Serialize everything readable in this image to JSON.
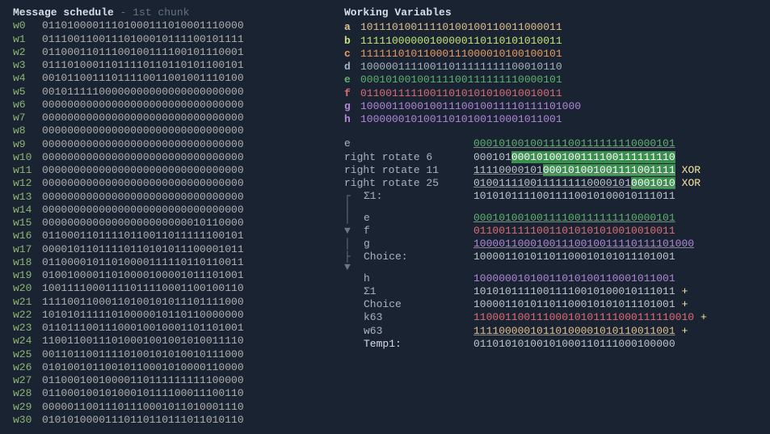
{
  "msgSchedule": {
    "title": "Message schedule",
    "subtitle": " - 1st chunk",
    "words": [
      {
        "label": "w0",
        "val": "01101000011101000111010001110000"
      },
      {
        "label": "w1",
        "val": "01110011001110100010111100101111"
      },
      {
        "label": "w2",
        "val": "01100011011100100111100101110001"
      },
      {
        "label": "w3",
        "val": "01110100011011110110110101100101"
      },
      {
        "label": "w4",
        "val": "00101100111011110011001001110100"
      },
      {
        "label": "w5",
        "val": "00101111100000000000000000000000"
      },
      {
        "label": "w6",
        "val": "00000000000000000000000000000000"
      },
      {
        "label": "w7",
        "val": "00000000000000000000000000000000"
      },
      {
        "label": "w8",
        "val": "00000000000000000000000000000000"
      },
      {
        "label": "w9",
        "val": "00000000000000000000000000000000"
      },
      {
        "label": "w10",
        "val": "00000000000000000000000000000000"
      },
      {
        "label": "w11",
        "val": "00000000000000000000000000000000"
      },
      {
        "label": "w12",
        "val": "00000000000000000000000000000000"
      },
      {
        "label": "w13",
        "val": "00000000000000000000000000000000"
      },
      {
        "label": "w14",
        "val": "00000000000000000000000000000000"
      },
      {
        "label": "w15",
        "val": "00000000000000000000000010110000"
      },
      {
        "label": "w16",
        "val": "01100011011110110011011111100101"
      },
      {
        "label": "w17",
        "val": "00001011011110110101011100001011"
      },
      {
        "label": "w18",
        "val": "01100001011010000111110110110011"
      },
      {
        "label": "w19",
        "val": "01001000011010000100001011101001"
      },
      {
        "label": "w20",
        "val": "10011110001111011110001100100110"
      },
      {
        "label": "w21",
        "val": "11110011000110100101011101111000"
      },
      {
        "label": "w22",
        "val": "10101011111010000010110110000000"
      },
      {
        "label": "w23",
        "val": "01101110011100010010001101101001"
      },
      {
        "label": "w24",
        "val": "11001100111010001001001010011110"
      },
      {
        "label": "w25",
        "val": "00110110011110100101010010111000"
      },
      {
        "label": "w26",
        "val": "01010010110010110001010000110000"
      },
      {
        "label": "w27",
        "val": "01100010010000110111111111100000"
      },
      {
        "label": "w28",
        "val": "01100010010100010111100011100110"
      },
      {
        "label": "w29",
        "val": "00000110011101110001011010001110"
      },
      {
        "label": "w30",
        "val": "01010100001110110110111011010110"
      }
    ]
  },
  "workingVars": {
    "title": "Working Variables",
    "vars": [
      {
        "name": "a",
        "val": "10111010011110100100110011000011",
        "cls": "c-a"
      },
      {
        "name": "b",
        "val": "11111000000100000110110101010011",
        "cls": "c-b"
      },
      {
        "name": "c",
        "val": "11111101011000111000010100100101",
        "cls": "c-c"
      },
      {
        "name": "d",
        "val": "10000011110011011111111100010110",
        "cls": "c-d"
      },
      {
        "name": "e",
        "val": "00010100100111100111111110000101",
        "cls": "c-e"
      },
      {
        "name": "f",
        "val": "01100111110011010101010010010011",
        "cls": "c-f"
      },
      {
        "name": "g",
        "val": "10000110001001110010011110111101000",
        "cls": "c-g"
      },
      {
        "name": "h",
        "val": "10000001010011010100110001011001",
        "cls": "c-h"
      }
    ]
  },
  "calc": {
    "e_label": "e",
    "e_val": "00010100100111100111111110000101",
    "rr6_lbl": "right rotate 6",
    "rr6_pre": "000101",
    "rr6_hl": "00010100100111100111111110",
    "rr11_lbl": "right rotate 11",
    "rr11_pre": "11110000101",
    "rr11_hl": "000101001001111001111",
    "rr25_lbl": "right rotate 25",
    "rr25_pre": "0100111100111111110000101",
    "rr25_hl": "0001010",
    "s1_lbl": "Σ1:",
    "s1_val": "10101011110011110010100010111011",
    "ch_e_lbl": "e",
    "ch_e_val": "00010100100111100111111110000101",
    "ch_f_lbl": "f",
    "ch_f_val": "01100111110011010101010010010011",
    "ch_g_lbl": "g",
    "ch_g_val": "10000110001001110010011110111101000",
    "choice_lbl": "Choice:",
    "choice_val": "10000110101101100010101011101001",
    "t1_h_lbl": "h",
    "t1_h_val": "10000001010011010100110001011001",
    "t1_s1_lbl": "Σ1",
    "t1_s1_val": "10101011110011110010100010111011",
    "t1_ch_lbl": "Choice",
    "t1_ch_val": "10000110101101100010101011101001",
    "t1_k_lbl": "k63",
    "t1_k_val": "11000110011100010101111000111110010",
    "t1_w_lbl": "w63",
    "t1_w_val": "11110000010110100001010110011001",
    "temp1_lbl": "Temp1:",
    "temp1_val": "01101010100101000110111000100000",
    "xor": "XOR",
    "plus": "+"
  }
}
